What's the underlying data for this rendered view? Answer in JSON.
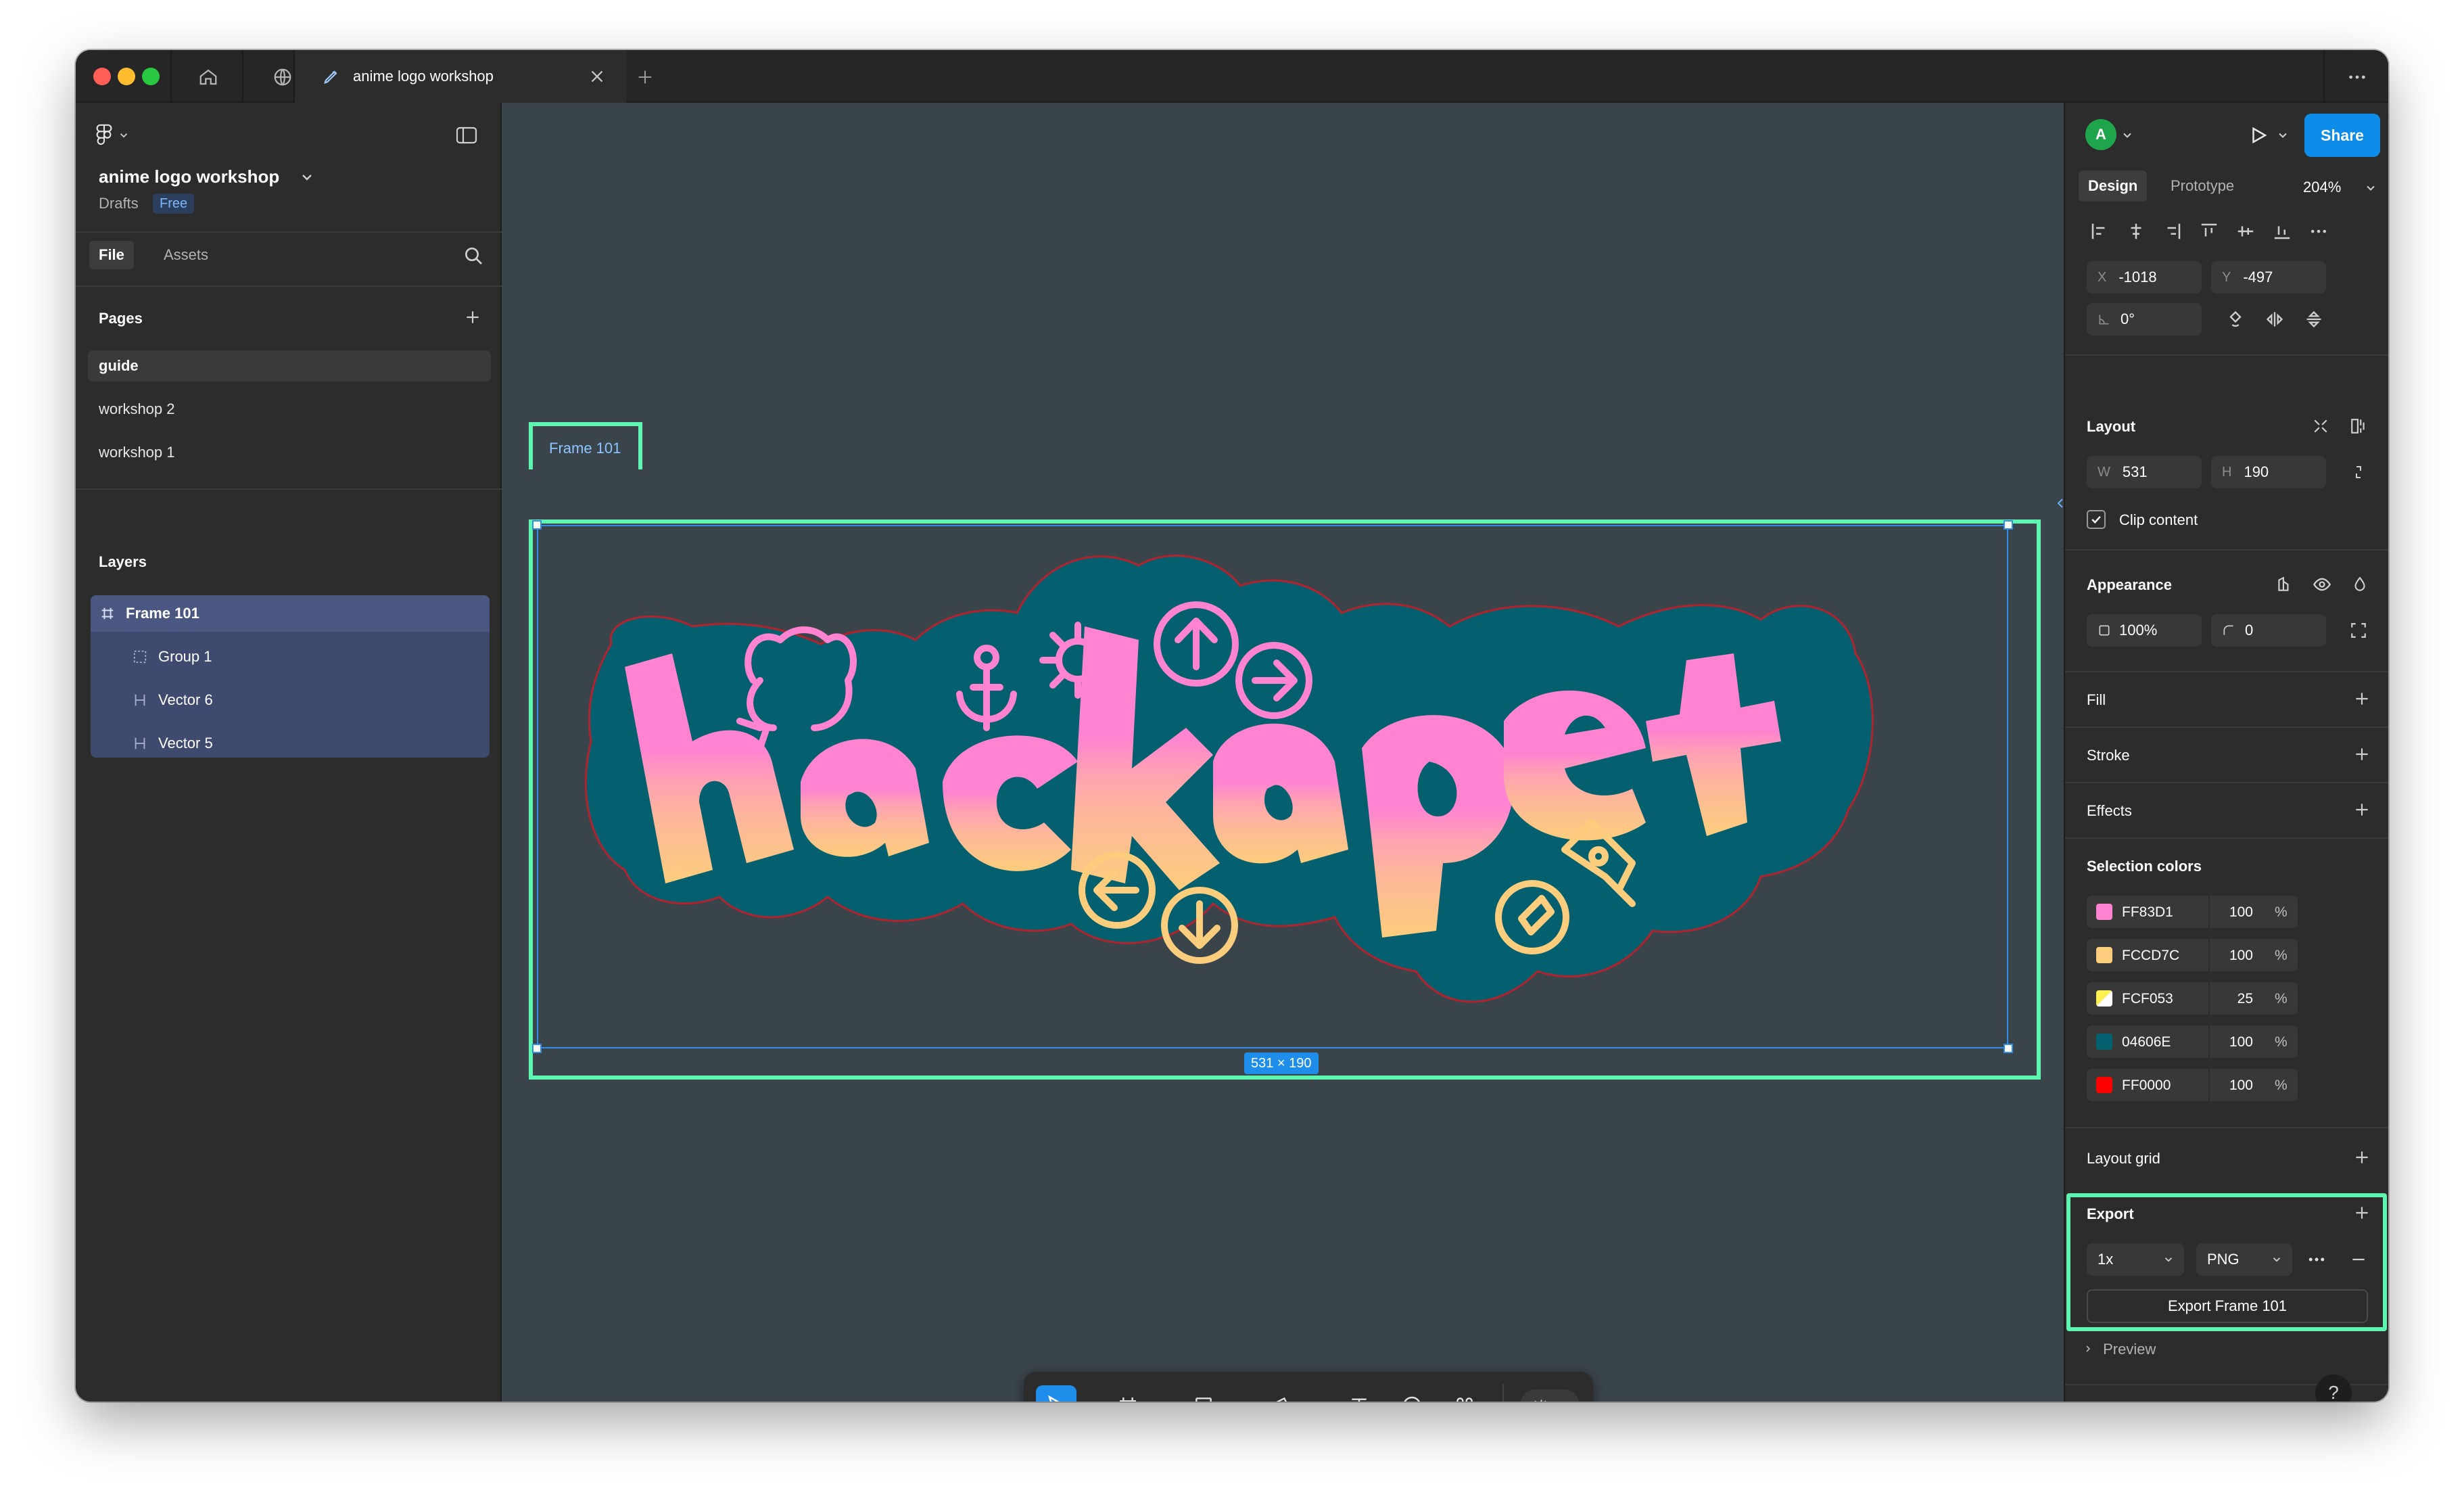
{
  "window": {
    "tab_title": "anime logo workshop"
  },
  "left_panel": {
    "file_name": "anime logo workshop",
    "location": "Drafts",
    "plan_badge": "Free",
    "tabs": {
      "file": "File",
      "assets": "Assets"
    },
    "pages_title": "Pages",
    "pages": [
      {
        "label": "guide",
        "active": true
      },
      {
        "label": "workshop 2",
        "active": false
      },
      {
        "label": "workshop 1",
        "active": false
      }
    ],
    "layers_title": "Layers",
    "layers": [
      {
        "label": "Frame 101",
        "icon": "frame-icon"
      },
      {
        "label": "Group 1",
        "icon": "group-icon"
      },
      {
        "label": "Vector 6",
        "icon": "vector-icon"
      },
      {
        "label": "Vector 5",
        "icon": "vector-icon"
      }
    ]
  },
  "canvas": {
    "frame_label": "Frame 101",
    "dimensions_badge": "531 × 190",
    "artwork_alt": "hackapet sticker logo"
  },
  "toolbar": {
    "tools": [
      "move-tool",
      "frame-tool",
      "shape-tool",
      "pen-tool",
      "text-tool",
      "comment-tool",
      "actions-tool"
    ],
    "active_tool": "move-tool",
    "dev_mode": false
  },
  "right_panel": {
    "avatar_initial": "A",
    "avatar_color": "#1fa64d",
    "share_label": "Share",
    "tabs": {
      "design": "Design",
      "prototype": "Prototype"
    },
    "zoom": "204%",
    "position": {
      "x_label": "X",
      "x": "-1018",
      "y_label": "Y",
      "y": "-497"
    },
    "rotation": "0°",
    "layout_title": "Layout",
    "size": {
      "w_label": "W",
      "w": "531",
      "h_label": "H",
      "h": "190"
    },
    "clip_content_label": "Clip content",
    "clip_content_checked": true,
    "appearance_title": "Appearance",
    "opacity": "100%",
    "corner_radius": "0",
    "fill_title": "Fill",
    "stroke_title": "Stroke",
    "effects_title": "Effects",
    "selection_colors_title": "Selection colors",
    "selection_colors": [
      {
        "hex": "FF83D1",
        "opacity": "100",
        "swatch": "#FF83D1"
      },
      {
        "hex": "FCCD7C",
        "opacity": "100",
        "swatch": "#FCCD7C"
      },
      {
        "hex": "FCF053",
        "opacity": "25",
        "swatch": "#FCF053"
      },
      {
        "hex": "04606E",
        "opacity": "100",
        "swatch": "#04606E"
      },
      {
        "hex": "FF0000",
        "opacity": "100",
        "swatch": "#FF0000"
      }
    ],
    "percent_sign": "%",
    "layout_grid_title": "Layout grid",
    "export_title": "Export",
    "export_scale": "1x",
    "export_format": "PNG",
    "export_button": "Export Frame 101",
    "preview_label": "Preview",
    "help_label": "?"
  },
  "colors": {
    "accent": "#0d8ce9",
    "highlight_outline": "#5ef5b0",
    "canvas_bg": "#3a444b",
    "sticker_teal": "#04606E",
    "sticker_pink": "#FF83D1",
    "sticker_yellow": "#FCCD7C"
  }
}
